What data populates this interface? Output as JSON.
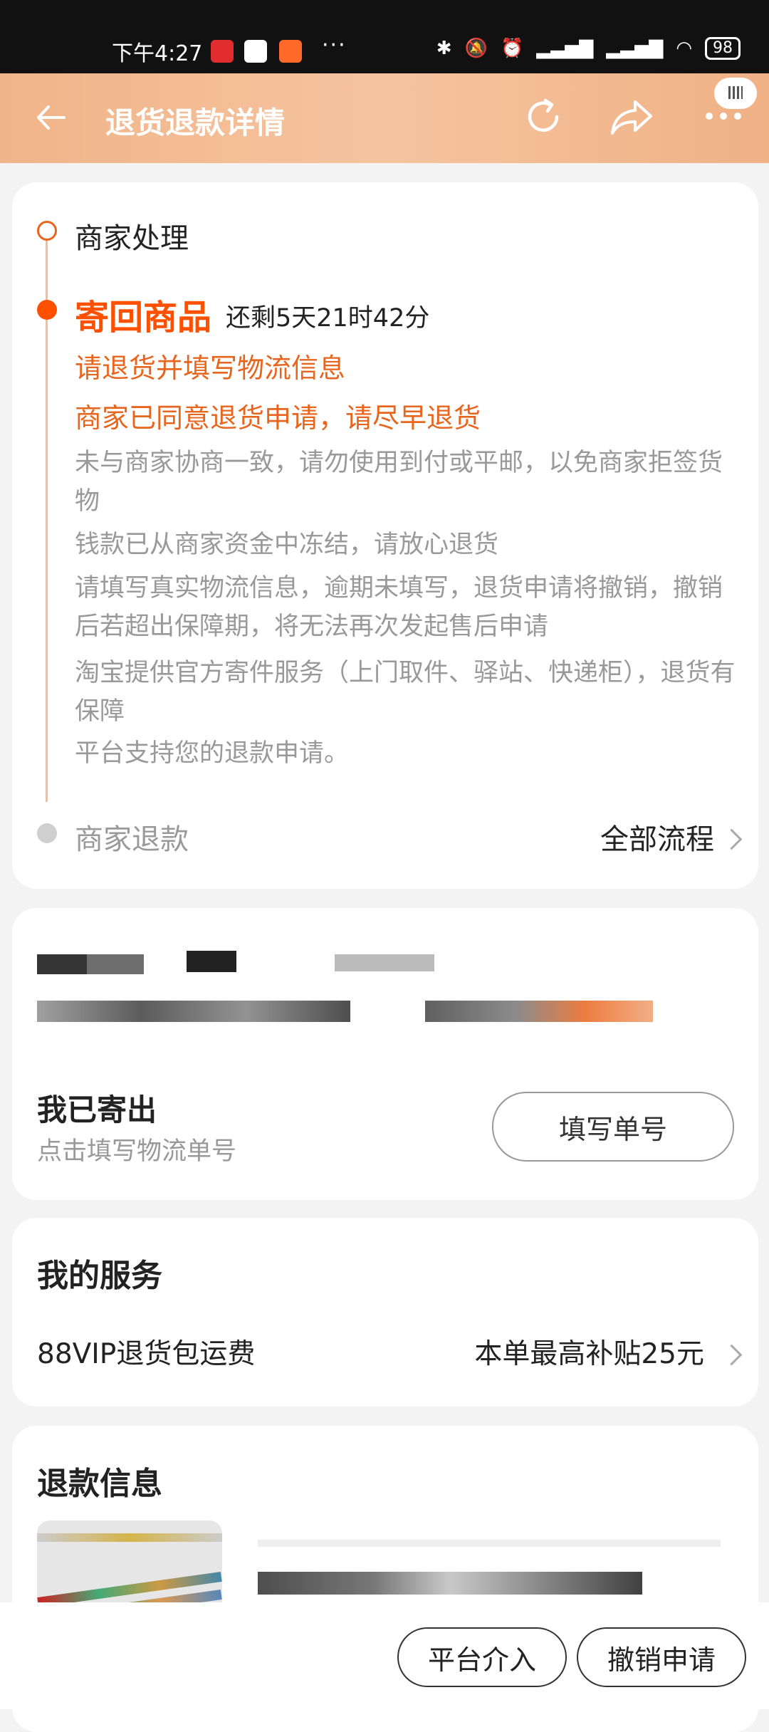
{
  "status_bar": {
    "time": "下午4:27",
    "battery": "98",
    "more": "···"
  },
  "header": {
    "title": "退货退款详情"
  },
  "progress": {
    "step1": "商家处理",
    "step2": "寄回商品",
    "countdown": "还剩5天21时42分",
    "notice1": "请退货并填写物流信息",
    "notice2": "商家已同意退货申请，请尽早退货",
    "tips": [
      "未与商家协商一致，请勿使用到付或平邮，以免商家拒签货物",
      "钱款已从商家资金中冻结，请放心退货",
      "请填写真实物流信息，逾期未填写，退货申请将撤销，撤销后若超出保障期，将无法再次发起售后申请",
      "淘宝提供官方寄件服务（上门取件、驿站、快递柜），退货有保障",
      "平台支持您的退款申请。"
    ],
    "step3": "商家退款",
    "all_flow": "全部流程"
  },
  "shipping": {
    "title": "我已寄出",
    "subtitle": "点击填写物流单号",
    "button": "填写单号"
  },
  "service": {
    "title": "我的服务",
    "name": "88VIP退货包运费",
    "detail": "本单最高补贴25元"
  },
  "refund_info": {
    "title": "退款信息"
  },
  "bottom": {
    "platform": "平台介入",
    "cancel": "撤销申请"
  },
  "colors": {
    "accent": "#ff5000",
    "header_bg": "#f3b98f"
  }
}
